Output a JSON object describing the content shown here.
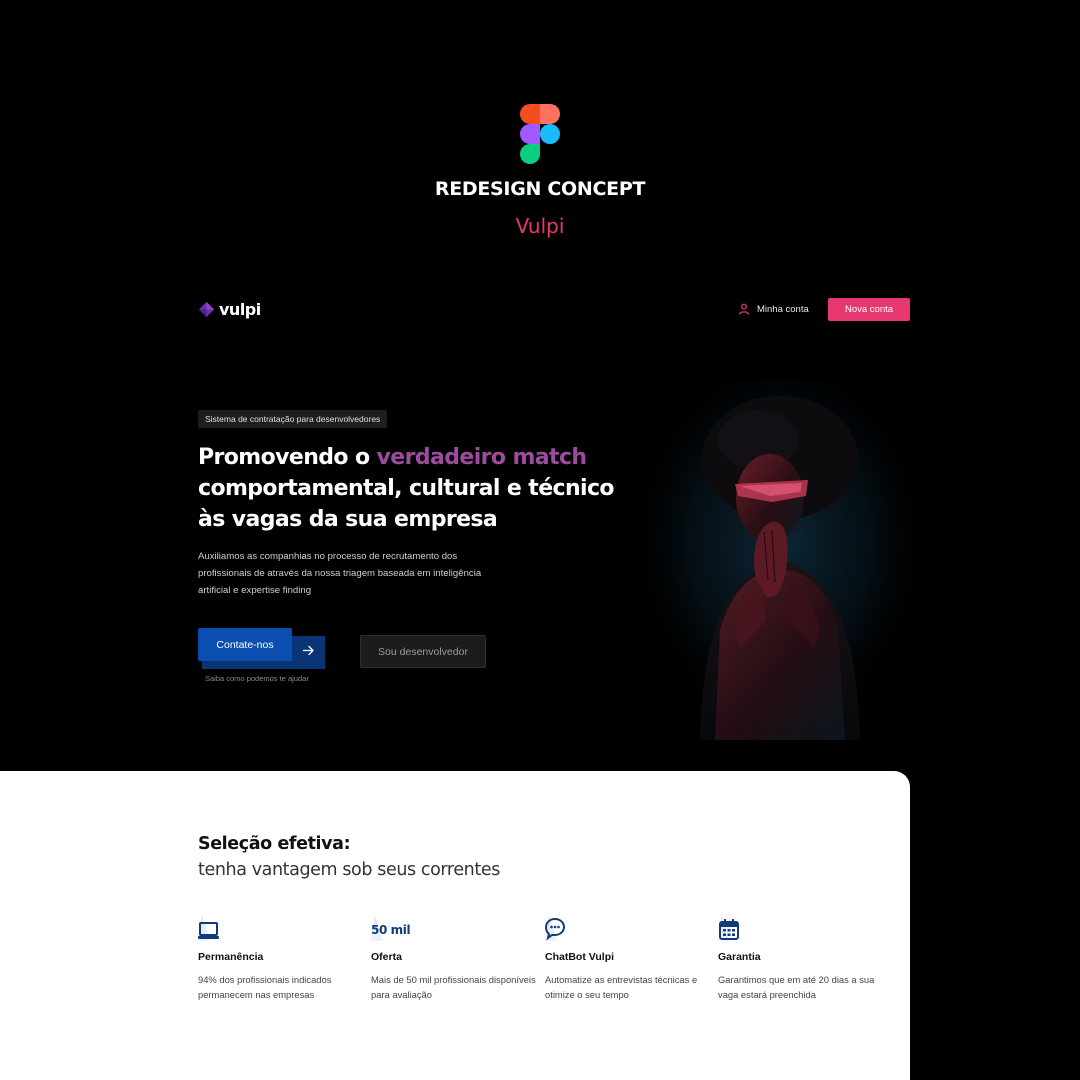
{
  "header": {
    "title": "REDESIGN CONCEPT",
    "subtitle": "Vulpi"
  },
  "nav": {
    "brand": "vulpi",
    "account_link": "Minha conta",
    "new_account_button": "Nova conta"
  },
  "hero": {
    "badge": "Sistema de contratação para desenvolvedores",
    "title_part1": "Promovendo o ",
    "title_highlight": "verdadeiro match",
    "title_part2": "comportamental, cultural e técnico às vagas da sua empresa",
    "description": "Auxiliamos as companhias no processo de recrutamento dos profissionais de através da nossa triagem baseada em inteligência artificial e expertise finding",
    "primary_button": "Contate-nos",
    "primary_note": "Saiba como podemos te ajudar",
    "secondary_button": "Sou desenvolvedor"
  },
  "selection": {
    "title": "Seleção efetiva:",
    "subtitle": "tenha vantagem sob seus correntes",
    "features": [
      {
        "icon": "laptop-icon",
        "title": "Permanência",
        "description": "94% dos profissionais indicados permanecem nas empresas"
      },
      {
        "icon": "fifty-thousand-icon",
        "icon_text": "50 mil",
        "title": "Oferta",
        "description": "Mais de 50 mil profissionais disponíveis para avaliação"
      },
      {
        "icon": "chatbot-icon",
        "title": "ChatBot Vulpi",
        "description": "Automatize as entrevistas técnicas e otimize o seu tempo"
      },
      {
        "icon": "calendar-icon",
        "title": "Garantia",
        "description": "Garantimos que em até 20 dias a sua vaga estará preenchida"
      }
    ]
  },
  "colors": {
    "background": "#000000",
    "accent_pink": "#e6386f",
    "highlight_purple": "#9d4b9e",
    "primary_blue": "#0a4fb0",
    "icon_navy": "#123b7a"
  }
}
